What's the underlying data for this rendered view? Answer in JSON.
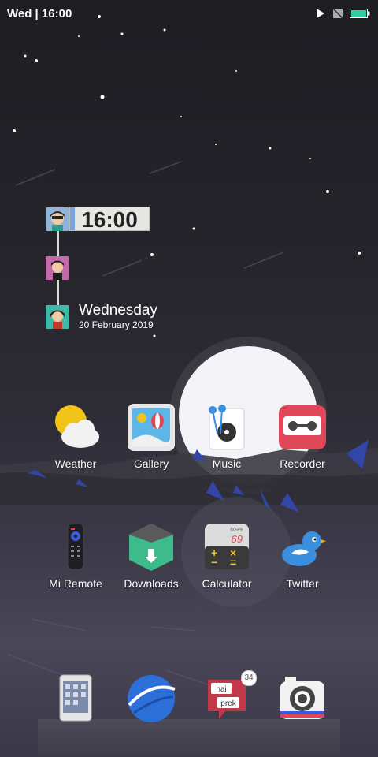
{
  "status_bar": {
    "time_text": "Wed | 16:00"
  },
  "clock_widget": {
    "time": "16:00",
    "day": "Wednesday",
    "date": "20 February 2019"
  },
  "apps": [
    {
      "label": "Weather"
    },
    {
      "label": "Gallery"
    },
    {
      "label": "Music"
    },
    {
      "label": "Recorder"
    },
    {
      "label": "Mi Remote"
    },
    {
      "label": "Downloads"
    },
    {
      "label": "Calculator"
    },
    {
      "label": "Twitter"
    }
  ],
  "calculator_icon": {
    "top_text": "60+9",
    "result": "69"
  },
  "dock": {
    "messenger_bubble_1": "hai",
    "messenger_bubble_2": "prek",
    "messenger_badge": "34"
  },
  "colors": {
    "accent_green": "#2ecfa2",
    "recorder_red": "#e0485a",
    "twitter_blue": "#3a8fdf"
  }
}
